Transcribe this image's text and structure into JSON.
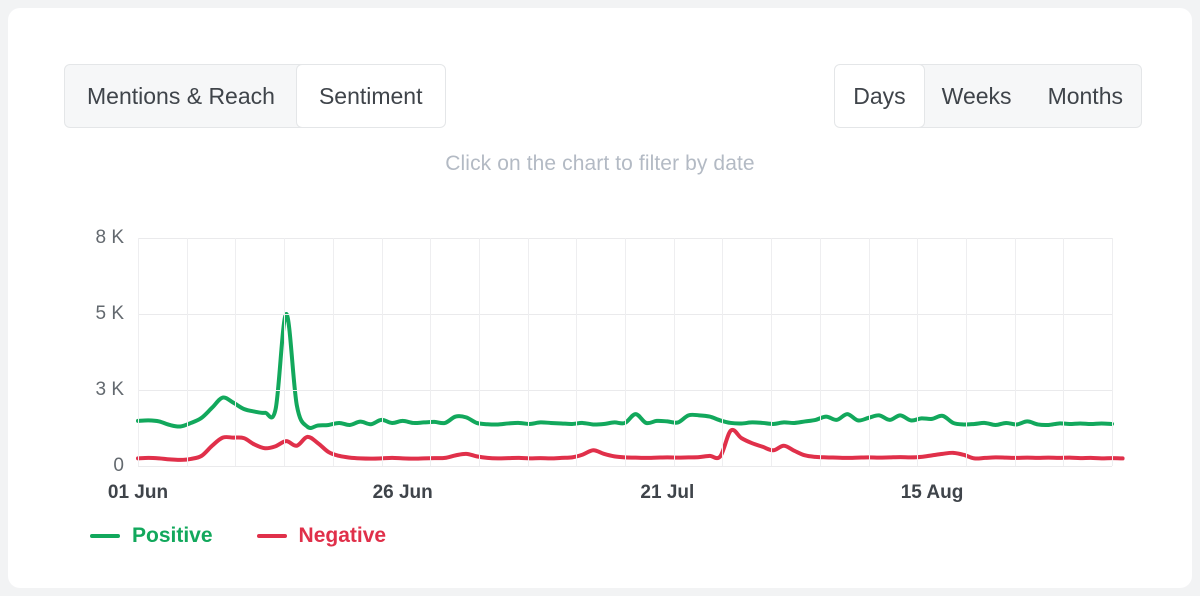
{
  "tabs": {
    "left_group": [
      {
        "label": "Mentions & Reach",
        "active": false
      },
      {
        "label": "Sentiment",
        "active": true
      }
    ],
    "right_group": [
      {
        "label": "Days",
        "active": true
      },
      {
        "label": "Weeks",
        "active": false
      },
      {
        "label": "Months",
        "active": false
      }
    ]
  },
  "hint": {
    "text": "Click on the chart to filter by date"
  },
  "legend": [
    {
      "label": "Positive",
      "color": "#12a85c"
    },
    {
      "label": "Negative",
      "color": "#e0304a"
    }
  ],
  "colors": {
    "positive": "#12a85c",
    "negative": "#e0304a",
    "grid": "#eeeef0",
    "axis_text": "#63696f",
    "hint_text": "#b3bac4",
    "card_bg": "#ffffff",
    "page_bg": "#f2f3f4",
    "segment_bg": "#f6f7f8",
    "segment_border": "#e4e6e8"
  },
  "chart_data": {
    "type": "line",
    "title": "",
    "xlabel": "",
    "ylabel": "",
    "grid": true,
    "legend_position": "bottom-left",
    "y_ticks": [
      {
        "label": "8 K",
        "value": 8000
      },
      {
        "label": "5 K",
        "value": 5000
      },
      {
        "label": "3 K",
        "value": 3000
      },
      {
        "label": "0",
        "value": 0
      }
    ],
    "y_tick_positions_pct": [
      0,
      33.33,
      66.67,
      100
    ],
    "ylim": [
      0,
      8000
    ],
    "x_ticks": [
      {
        "label": "01 Jun",
        "index": 0
      },
      {
        "label": "26 Jun",
        "index": 25
      },
      {
        "label": "21 Jul",
        "index": 50
      },
      {
        "label": "15 Aug",
        "index": 75
      }
    ],
    "x_gridline_count": 20,
    "n_points": 93,
    "series": [
      {
        "name": "Positive",
        "color": "#12a85c",
        "values": [
          1780,
          1800,
          1760,
          1620,
          1560,
          1700,
          1900,
          2300,
          2700,
          2500,
          2250,
          2150,
          2100,
          2250,
          5000,
          2400,
          1550,
          1600,
          1620,
          1700,
          1620,
          1750,
          1650,
          1820,
          1700,
          1780,
          1700,
          1720,
          1740,
          1700,
          1950,
          1920,
          1700,
          1650,
          1640,
          1680,
          1700,
          1660,
          1720,
          1700,
          1680,
          1660,
          1700,
          1640,
          1660,
          1720,
          1700,
          2050,
          1700,
          1780,
          1760,
          1720,
          2000,
          2000,
          1950,
          1800,
          1700,
          1680,
          1720,
          1700,
          1660,
          1720,
          1700,
          1760,
          1820,
          1950,
          1820,
          2050,
          1800,
          1900,
          2000,
          1820,
          2000,
          1800,
          1880,
          1860,
          1980,
          1700,
          1640,
          1660,
          1700,
          1620,
          1700,
          1640,
          1760,
          1640,
          1620,
          1680,
          1660,
          1680,
          1660,
          1680,
          1660
        ]
      },
      {
        "name": "Negative",
        "color": "#e0304a",
        "values": [
          300,
          320,
          300,
          260,
          240,
          280,
          400,
          800,
          1120,
          1120,
          1100,
          850,
          700,
          780,
          980,
          800,
          1150,
          900,
          550,
          400,
          330,
          300,
          290,
          300,
          320,
          300,
          290,
          300,
          310,
          320,
          420,
          480,
          380,
          320,
          300,
          310,
          320,
          300,
          310,
          300,
          320,
          340,
          450,
          620,
          480,
          380,
          340,
          330,
          320,
          330,
          340,
          330,
          340,
          350,
          400,
          380,
          1400,
          1100,
          900,
          760,
          620,
          800,
          600,
          420,
          360,
          340,
          330,
          320,
          330,
          340,
          330,
          340,
          350,
          340,
          360,
          420,
          480,
          520,
          440,
          300,
          320,
          340,
          330,
          320,
          330,
          320,
          330,
          320,
          330,
          310,
          320,
          300,
          310,
          300
        ]
      }
    ]
  }
}
